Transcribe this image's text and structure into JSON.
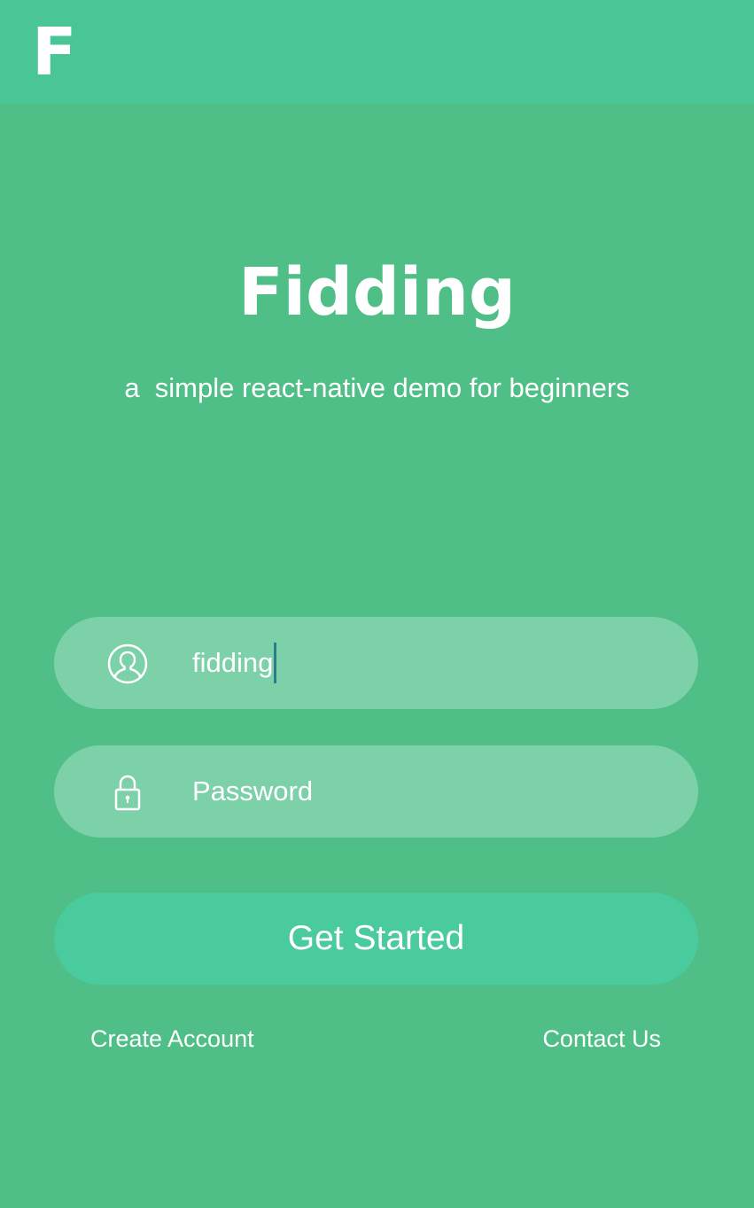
{
  "header": {
    "logo_letter": "F"
  },
  "hero": {
    "title": "Fidding",
    "subtitle": "a  simple react-native demo for beginners"
  },
  "form": {
    "username": {
      "icon": "user-icon",
      "value": "fidding"
    },
    "password": {
      "icon": "lock-icon",
      "placeholder": "Password"
    },
    "submit_label": "Get Started"
  },
  "footer": {
    "create_account": "Create Account",
    "contact_us": "Contact Us"
  }
}
